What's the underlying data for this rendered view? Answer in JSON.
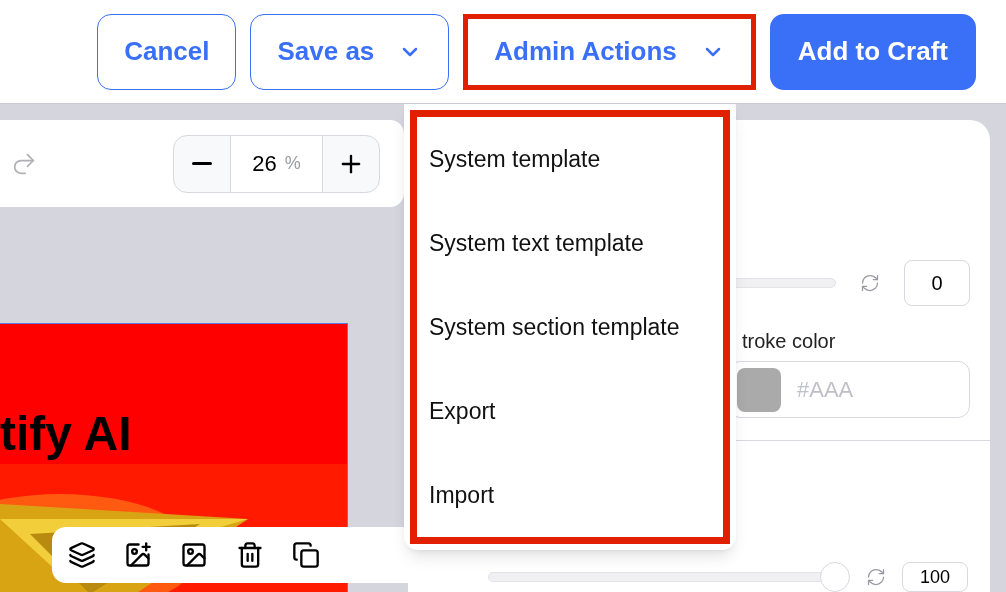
{
  "header": {
    "buttons": [
      {
        "label": "Cancel",
        "kind": "outline"
      },
      {
        "label": "Save as",
        "kind": "dropdown",
        "highlighted": false
      },
      {
        "label": "Admin Actions",
        "kind": "dropdown",
        "highlighted": true
      },
      {
        "label": "Add to Craft",
        "kind": "primary"
      }
    ]
  },
  "zoom": {
    "value": "26",
    "unit": "%"
  },
  "artboard": {
    "title": "tify AI"
  },
  "properties": {
    "first_slider": {
      "value": "0"
    },
    "stroke": {
      "label": "troke color",
      "color": "#aaaaaa",
      "placeholder": "#AAA"
    },
    "second_slider": {
      "level": 1,
      "value": "100"
    }
  },
  "menu": {
    "highlighted": true,
    "items": [
      "System template",
      "System text template",
      "System section template",
      "Export",
      "Import"
    ]
  }
}
